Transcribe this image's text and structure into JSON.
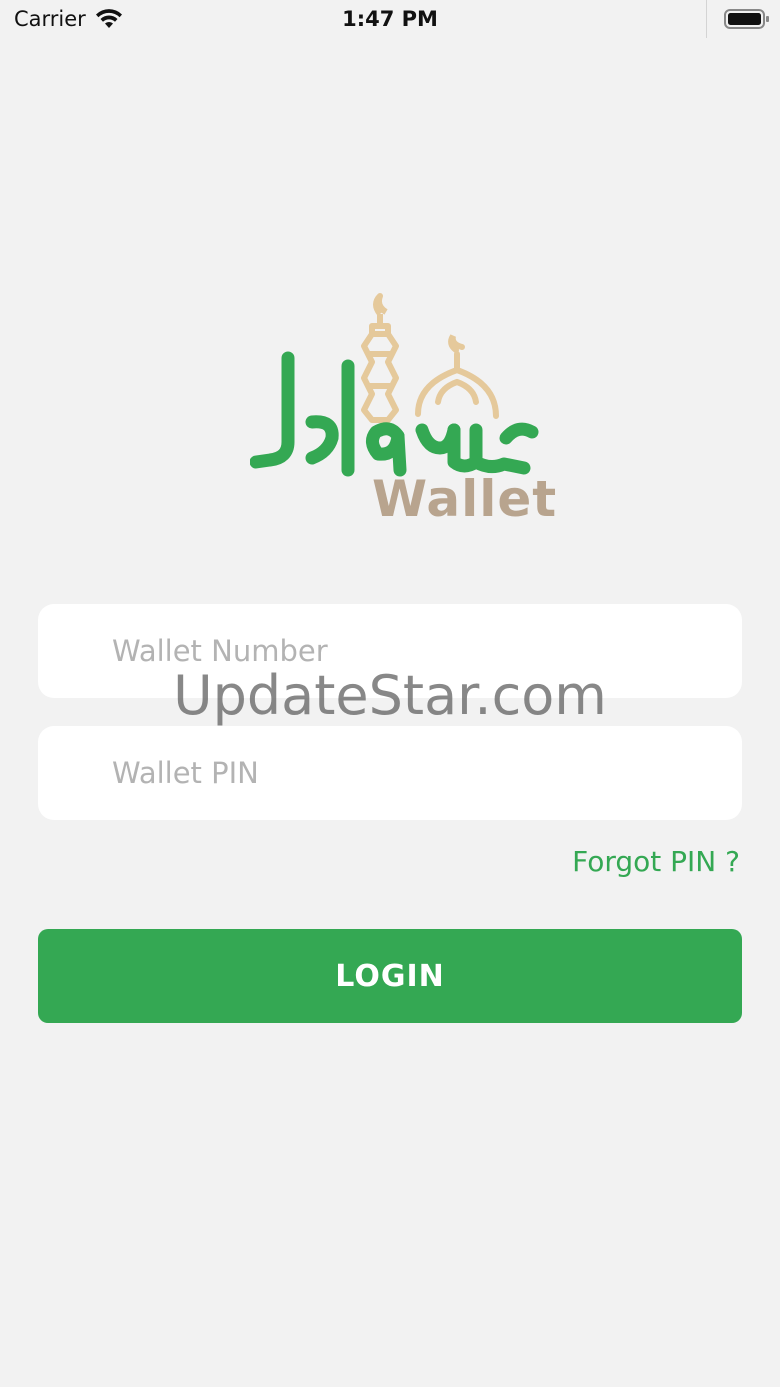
{
  "status_bar": {
    "carrier": "Carrier",
    "time": "1:47 PM"
  },
  "logo": {
    "brand_script": "Islamic",
    "brand_word": "Wallet",
    "green": "#34a853",
    "gold": "#e5c99b",
    "taupe": "#b8a48e"
  },
  "form": {
    "wallet_number_placeholder": "Wallet Number",
    "wallet_pin_placeholder": "Wallet PIN",
    "forgot_pin": "Forgot PIN ?",
    "login": "LOGIN"
  },
  "watermark": "UpdateStar.com",
  "icons": {
    "wifi": "wifi-icon",
    "battery": "battery-icon",
    "mosque": "mosque-icon"
  }
}
